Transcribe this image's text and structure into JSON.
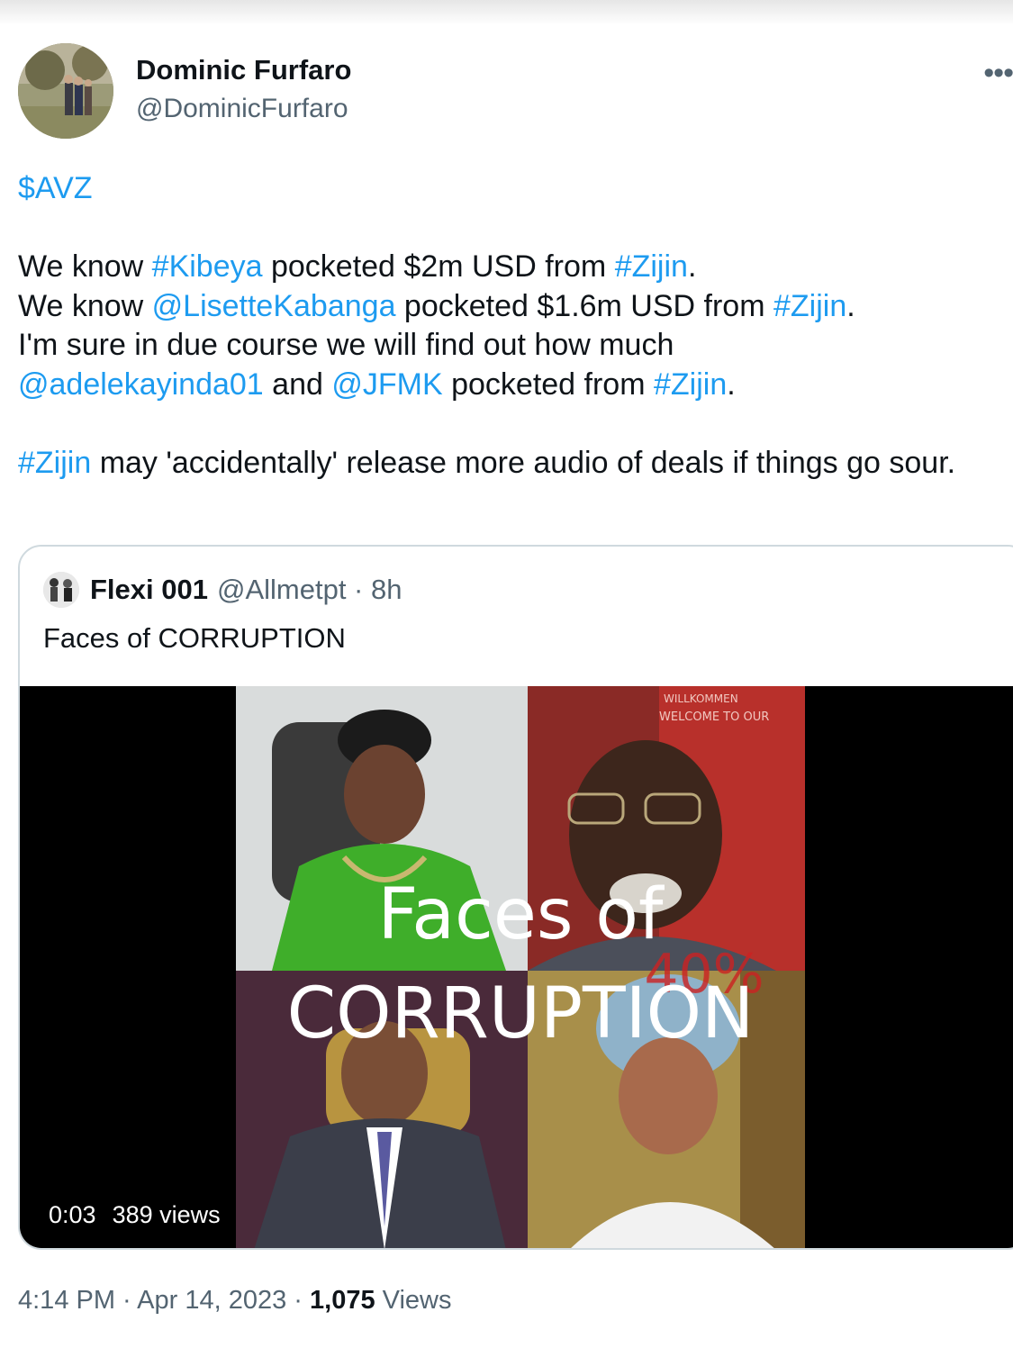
{
  "author": {
    "name": "Dominic Furfaro",
    "handle": "@DominicFurfaro"
  },
  "tweet": {
    "cashtag": "$AVZ",
    "line1": {
      "a": "We know ",
      "tag1": "#Kibeya",
      "b": " pocketed $2m USD from ",
      "tag2": "#Zijin",
      "c": "."
    },
    "line2": {
      "a": "We know ",
      "mention": "@LisetteKabanga",
      "b": " pocketed $1.6m USD from ",
      "tag": "#Zijin",
      "c": "."
    },
    "line3": "I'm sure in due course we will find out how much",
    "line4": {
      "mention1": "@adelekayinda01",
      "a": " and ",
      "mention2": "@JFMK",
      "b": " pocketed from ",
      "tag": "#Zijin",
      "c": "."
    },
    "line5": {
      "tag": "#Zijin",
      "a": " may 'accidentally' release more audio of deals if things go sour."
    }
  },
  "quoted": {
    "name": "Flexi 001",
    "handle": "@Allmetpt · 8h",
    "text": "Faces of CORRUPTION",
    "video": {
      "overlay_line1": "Faces of",
      "overlay_line2": "CORRUPTION",
      "overlay_percent": "40%",
      "sign_text1": "WILLKOMMEN",
      "sign_text2": "WELCOME TO OUR",
      "duration": "0:03",
      "views": "389 views"
    }
  },
  "footer": {
    "time_date": "4:14 PM · Apr 14, 2023 · ",
    "views_count": "1,075",
    "views_label": " Views"
  },
  "colors": {
    "link": "#1d9bf0",
    "secondary": "#536471",
    "border": "#cfd9de"
  }
}
